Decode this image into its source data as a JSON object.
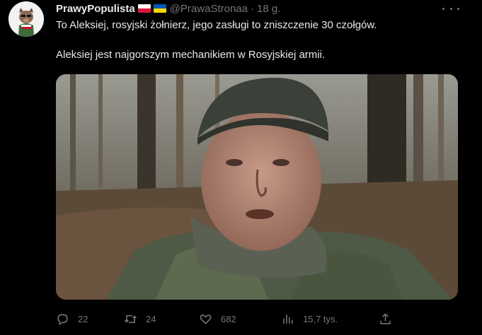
{
  "author": {
    "name": "PrawyPopulista",
    "handle": "@PrawaStronaa",
    "separator": "·",
    "time": "18 g."
  },
  "tweet": {
    "line1": "To Aleksiej, rosyjski żołnierz, jego zasługi to zniszczenie 30 czołgów.",
    "line2": "Aleksiej jest najgorszym mechanikiem w Rosyjskiej armii."
  },
  "icons": {
    "more": "more-icon",
    "reply": "reply-icon",
    "retweet": "retweet-icon",
    "like": "like-icon",
    "views": "views-icon",
    "share": "share-icon"
  },
  "actions": {
    "replies": "22",
    "retweets": "24",
    "likes": "682",
    "views": "15,7 tys."
  },
  "colors": {
    "background": "#000000",
    "text": "#e7e9ea",
    "muted": "#71767b"
  }
}
